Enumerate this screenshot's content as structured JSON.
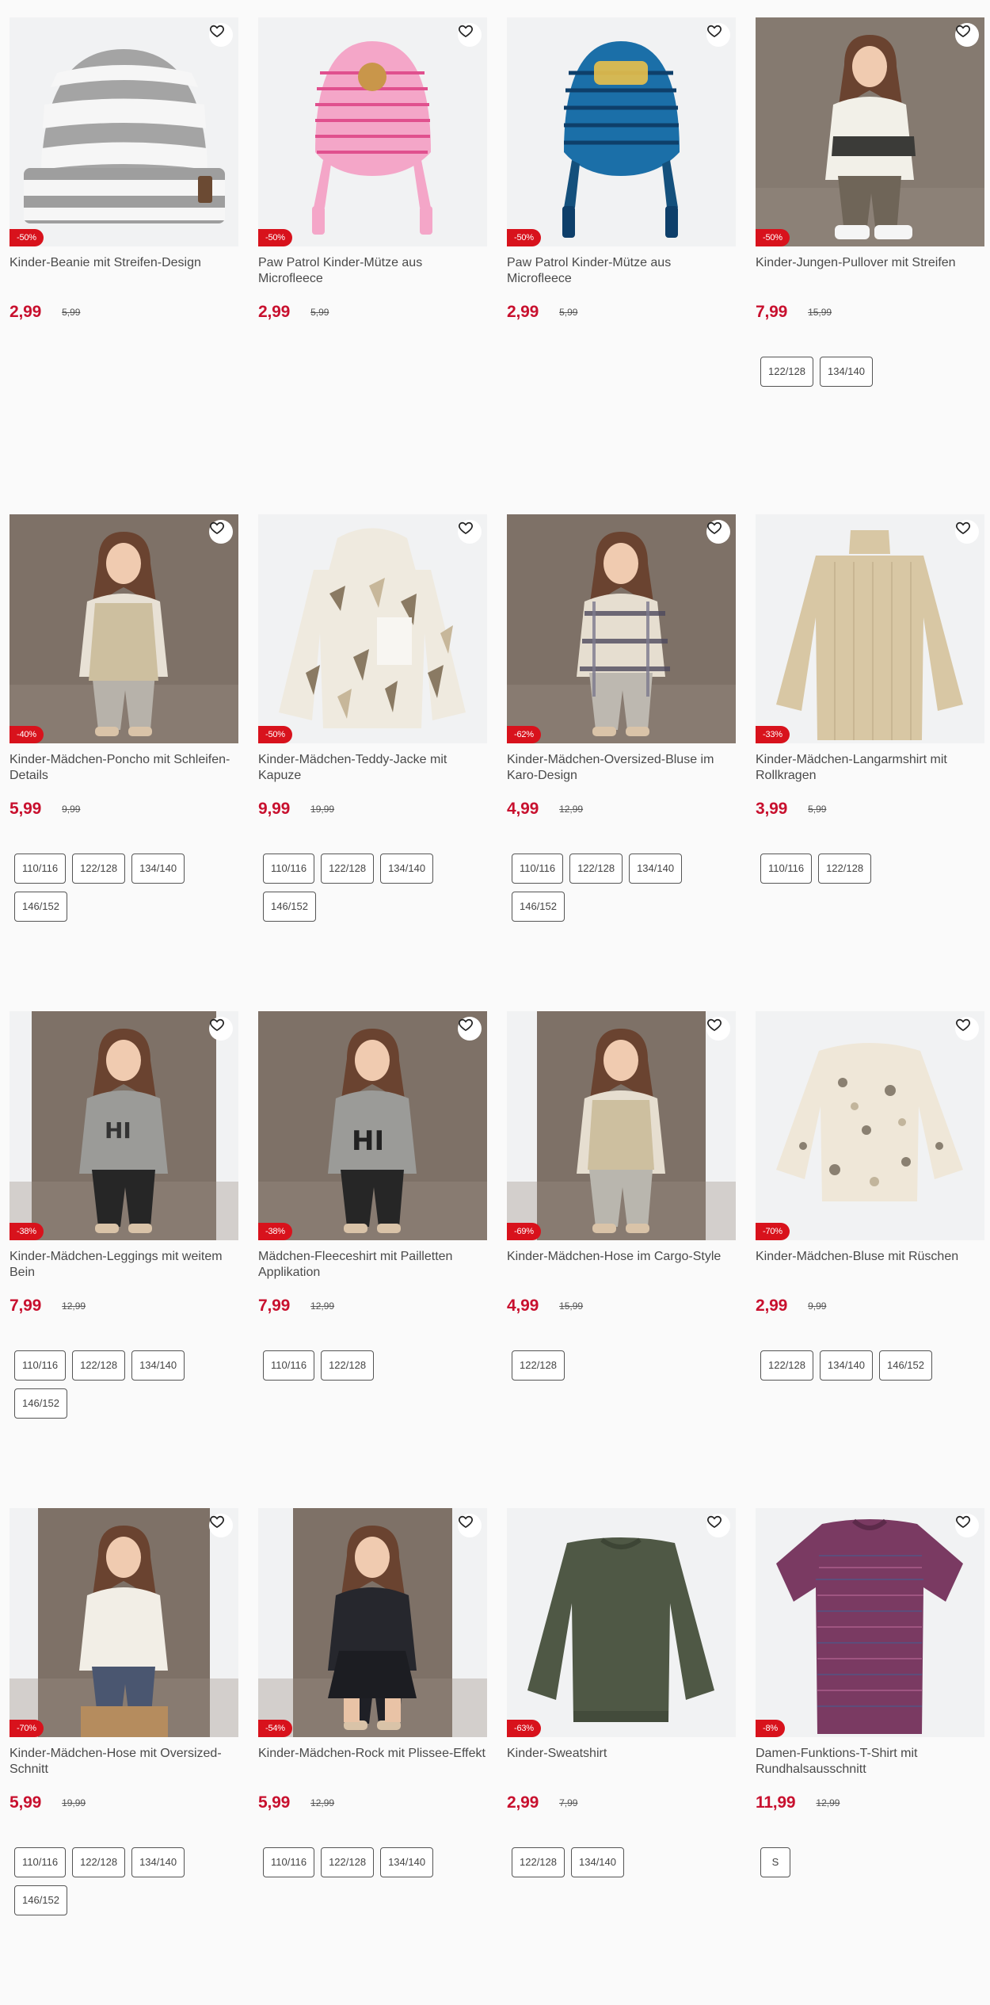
{
  "products": [
    {
      "title": "Kinder-Beanie mit Streifen-Design",
      "badge": "-50%",
      "price": "2,99",
      "old_price": "5,99",
      "sizes": [],
      "image": "beanie-stripes",
      "image_bg": "#f1f2f3"
    },
    {
      "title": "Paw Patrol Kinder-Mütze aus Microfleece",
      "badge": "-50%",
      "price": "2,99",
      "old_price": "5,99",
      "sizes": [],
      "image": "hat-pink",
      "image_bg": "#f1f2f3"
    },
    {
      "title": "Paw Patrol Kinder-Mütze aus Microfleece",
      "badge": "-50%",
      "price": "2,99",
      "old_price": "5,99",
      "sizes": [],
      "image": "hat-blue",
      "image_bg": "#f1f2f3"
    },
    {
      "title": "Kinder-Jungen-Pullover mit Streifen",
      "badge": "-50%",
      "price": "7,99",
      "old_price": "15,99",
      "sizes": [
        "122/128",
        "134/140"
      ],
      "image": "boy-pullover",
      "image_bg": "#857a70"
    },
    {
      "title": "Kinder-Mädchen-Poncho mit Schleifen-Details",
      "badge": "-40%",
      "price": "5,99",
      "old_price": "9,99",
      "sizes": [
        "110/116",
        "122/128",
        "134/140",
        "146/152"
      ],
      "image": "girl-poncho",
      "image_bg": "#7e7167"
    },
    {
      "title": "Kinder-Mädchen-Teddy-Jacke mit Kapuze",
      "badge": "-50%",
      "price": "9,99",
      "old_price": "19,99",
      "sizes": [
        "110/116",
        "122/128",
        "134/140",
        "146/152"
      ],
      "image": "teddy-jacket",
      "image_bg": "#f1f2f3"
    },
    {
      "title": "Kinder-Mädchen-Oversized-Bluse im Karo-Design",
      "badge": "-62%",
      "price": "4,99",
      "old_price": "12,99",
      "sizes": [
        "110/116",
        "122/128",
        "134/140",
        "146/152"
      ],
      "image": "girl-plaid",
      "image_bg": "#7e7167"
    },
    {
      "title": "Kinder-Mädchen-Langarmshirt mit Rollkragen",
      "badge": "-33%",
      "price": "3,99",
      "old_price": "5,99",
      "sizes": [
        "110/116",
        "122/128"
      ],
      "image": "turtleneck",
      "image_bg": "#f1f2f3"
    },
    {
      "title": "Kinder-Mädchen-Leggings mit weitem Bein",
      "badge": "-38%",
      "price": "7,99",
      "old_price": "12,99",
      "sizes": [
        "110/116",
        "122/128",
        "134/140",
        "146/152"
      ],
      "image": "girl-hi-leggings",
      "image_bg": "#f1f2f3"
    },
    {
      "title": "Mädchen-Fleeceshirt mit Pailletten Applikation",
      "badge": "-38%",
      "price": "7,99",
      "old_price": "12,99",
      "sizes": [
        "110/116",
        "122/128"
      ],
      "image": "girl-hi-fleece",
      "image_bg": "#7e7167"
    },
    {
      "title": "Kinder-Mädchen-Hose im Cargo-Style",
      "badge": "-69%",
      "price": "4,99",
      "old_price": "15,99",
      "sizes": [
        "122/128"
      ],
      "image": "girl-cargo",
      "image_bg": "#f1f2f3"
    },
    {
      "title": "Kinder-Mädchen-Bluse mit Rüschen",
      "badge": "-70%",
      "price": "2,99",
      "old_price": "9,99",
      "sizes": [
        "122/128",
        "134/140",
        "146/152"
      ],
      "image": "floral-blouse",
      "image_bg": "#f1f2f3"
    },
    {
      "title": "Kinder-Mädchen-Hose mit Oversized-Schnitt",
      "badge": "-70%",
      "price": "5,99",
      "old_price": "19,99",
      "sizes": [
        "110/116",
        "122/128",
        "134/140",
        "146/152"
      ],
      "image": "girl-fleece-white",
      "image_bg": "#f1f2f3"
    },
    {
      "title": "Kinder-Mädchen-Rock mit Plissee-Effekt",
      "badge": "-54%",
      "price": "5,99",
      "old_price": "12,99",
      "sizes": [
        "110/116",
        "122/128",
        "134/140"
      ],
      "image": "girl-skirt",
      "image_bg": "#f1f2f3"
    },
    {
      "title": "Kinder-Sweatshirt",
      "badge": "-63%",
      "price": "2,99",
      "old_price": "7,99",
      "sizes": [
        "122/128",
        "134/140"
      ],
      "image": "sweatshirt-olive",
      "image_bg": "#f1f2f3"
    },
    {
      "title": "Damen-Funktions-T-Shirt mit Rundhalsausschnitt",
      "badge": "-8%",
      "price": "11,99",
      "old_price": "12,99",
      "sizes": [
        "S"
      ],
      "image": "tshirt-purple",
      "image_bg": "#f1f2f3"
    }
  ],
  "colors": {
    "accent": "#c8102e",
    "badge": "#d8121c"
  },
  "icons": {
    "favorite": "heart-outline-icon"
  }
}
